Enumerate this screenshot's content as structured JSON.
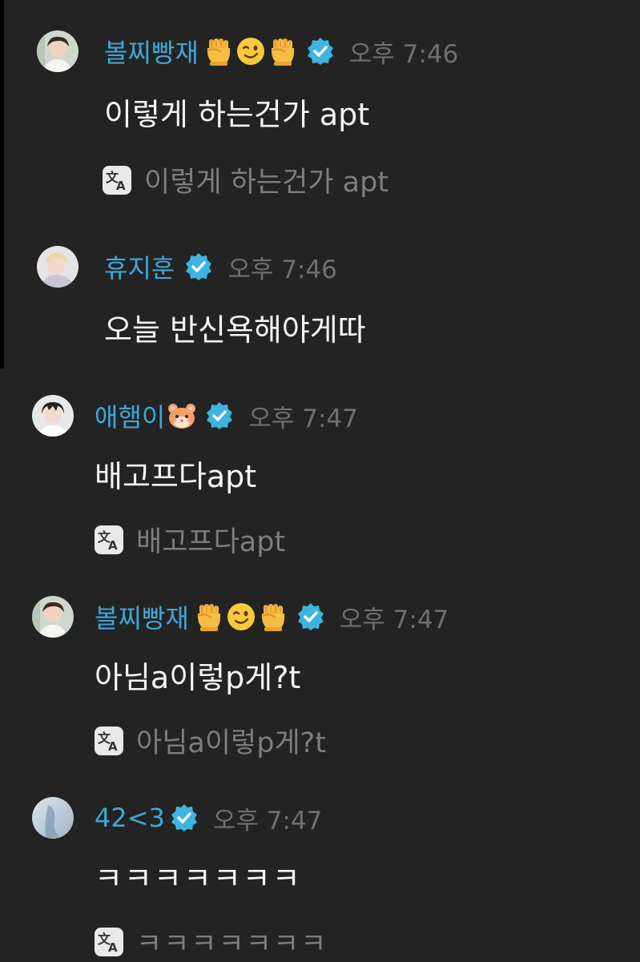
{
  "messages": [
    {
      "author": "볼찌빵재",
      "emojis": [
        "fist-emoji",
        "winking-face-emoji",
        "fist-emoji"
      ],
      "verified": true,
      "time": "오후 7:46",
      "text": "이렇게 하는건가 apt",
      "translation": "이렇게 하는건가 apt"
    },
    {
      "author": "휴지훈",
      "emojis": [],
      "verified": true,
      "time": "오후 7:46",
      "text": "오늘 반신욕해야게따",
      "translation": null
    },
    {
      "author": "애햄이",
      "emojis": [
        "hamster-emoji"
      ],
      "verified": true,
      "time": "오후 7:47",
      "text": "배고프다apt",
      "translation": "배고프다apt"
    },
    {
      "author": "볼찌빵재",
      "emojis": [
        "fist-emoji",
        "winking-face-emoji",
        "fist-emoji"
      ],
      "verified": true,
      "time": "오후 7:47",
      "text": "아님a이렇p게?t",
      "translation": "아님a이렇p게?t"
    },
    {
      "author": "42<3",
      "emojis": [],
      "verified": true,
      "time": "오후 7:47",
      "text": "ㅋㅋㅋㅋㅋㅋㅋ",
      "translation": "ㅋㅋㅋㅋㅋㅋㅋ"
    }
  ],
  "colors": {
    "background": "#232323",
    "author_name": "#3fa7d6",
    "verified_badge": "#3fb4e0",
    "timestamp": "#6f6f6f",
    "message_text": "#f4f4f4",
    "translation_text": "#7d7d7d"
  }
}
